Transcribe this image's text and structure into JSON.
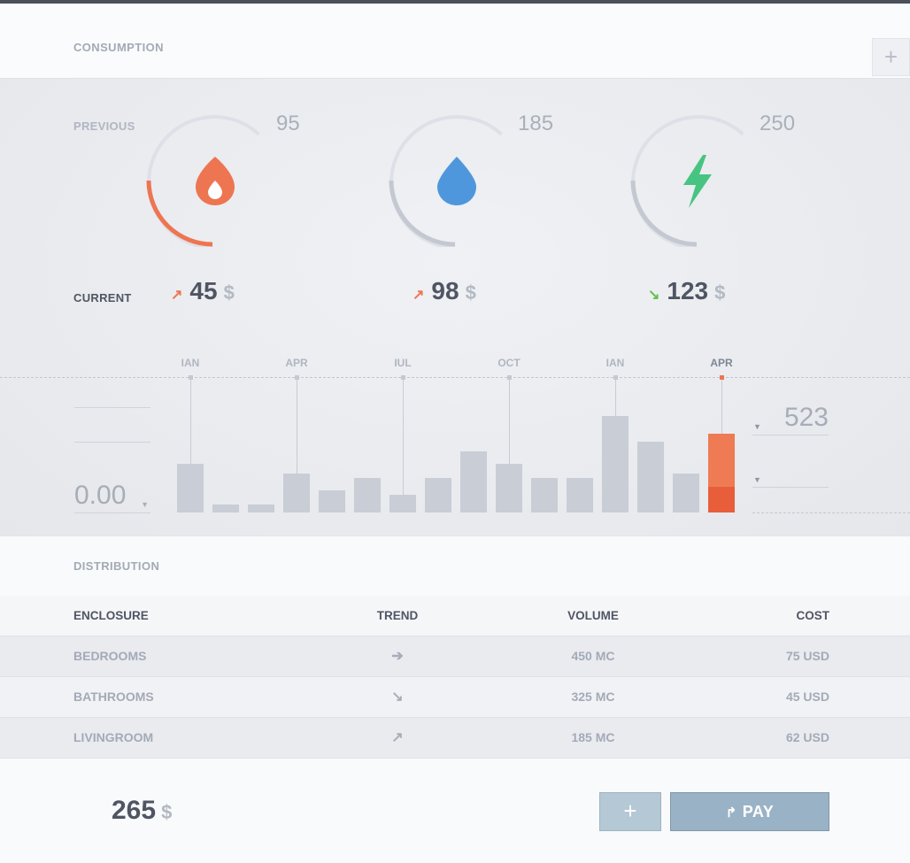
{
  "header": {
    "title": "CONSUMPTION",
    "add_icon": "plus-icon"
  },
  "labels": {
    "previous": "PREVIOUS",
    "current": "CURRENT"
  },
  "colors": {
    "fire": "#ee7551",
    "water": "#4f97dc",
    "power": "#47c482",
    "arc_gray": "#c3c8d1",
    "track": "#dde0e6",
    "up": "#ee7551",
    "down": "#5cc24a"
  },
  "meters": [
    {
      "icon": "fire-drop-icon",
      "previous": "95",
      "current": "45",
      "currency": "$",
      "trend": "up",
      "fill_color": "#ee7551"
    },
    {
      "icon": "water-drop-icon",
      "previous": "185",
      "current": "98",
      "currency": "$",
      "trend": "up",
      "fill_color": "#c3c8d1"
    },
    {
      "icon": "lightning-icon",
      "previous": "250",
      "current": "123",
      "currency": "$",
      "trend": "down",
      "fill_color": "#c3c8d1"
    }
  ],
  "history": {
    "months": [
      "IAN",
      "APR",
      "IUL",
      "OCT",
      "IAN",
      "APR"
    ],
    "bars": [
      55,
      9,
      9,
      44,
      25,
      39,
      20,
      39,
      69,
      55,
      39,
      39,
      109,
      80,
      44,
      89
    ],
    "active_bar": 15,
    "amount": "0.00",
    "value_right": "523"
  },
  "distribution": {
    "title": "DISTRIBUTION",
    "columns": [
      "ENCLOSURE",
      "TREND",
      "VOLUME",
      "COST"
    ],
    "rows": [
      {
        "enclosure": "BEDROOMS",
        "trend": "right",
        "volume": "450 MC",
        "cost": "75 USD"
      },
      {
        "enclosure": "BATHROOMS",
        "trend": "down-right",
        "volume": "325 MC",
        "cost": "45 USD"
      },
      {
        "enclosure": "LIVINGROOM",
        "trend": "up-right",
        "volume": "185 MC",
        "cost": "62 USD"
      }
    ]
  },
  "footer": {
    "total": "265",
    "currency": "$",
    "pay_label": "PAY",
    "pay_icon": "share-arrow-icon",
    "add_icon": "plus-icon"
  }
}
